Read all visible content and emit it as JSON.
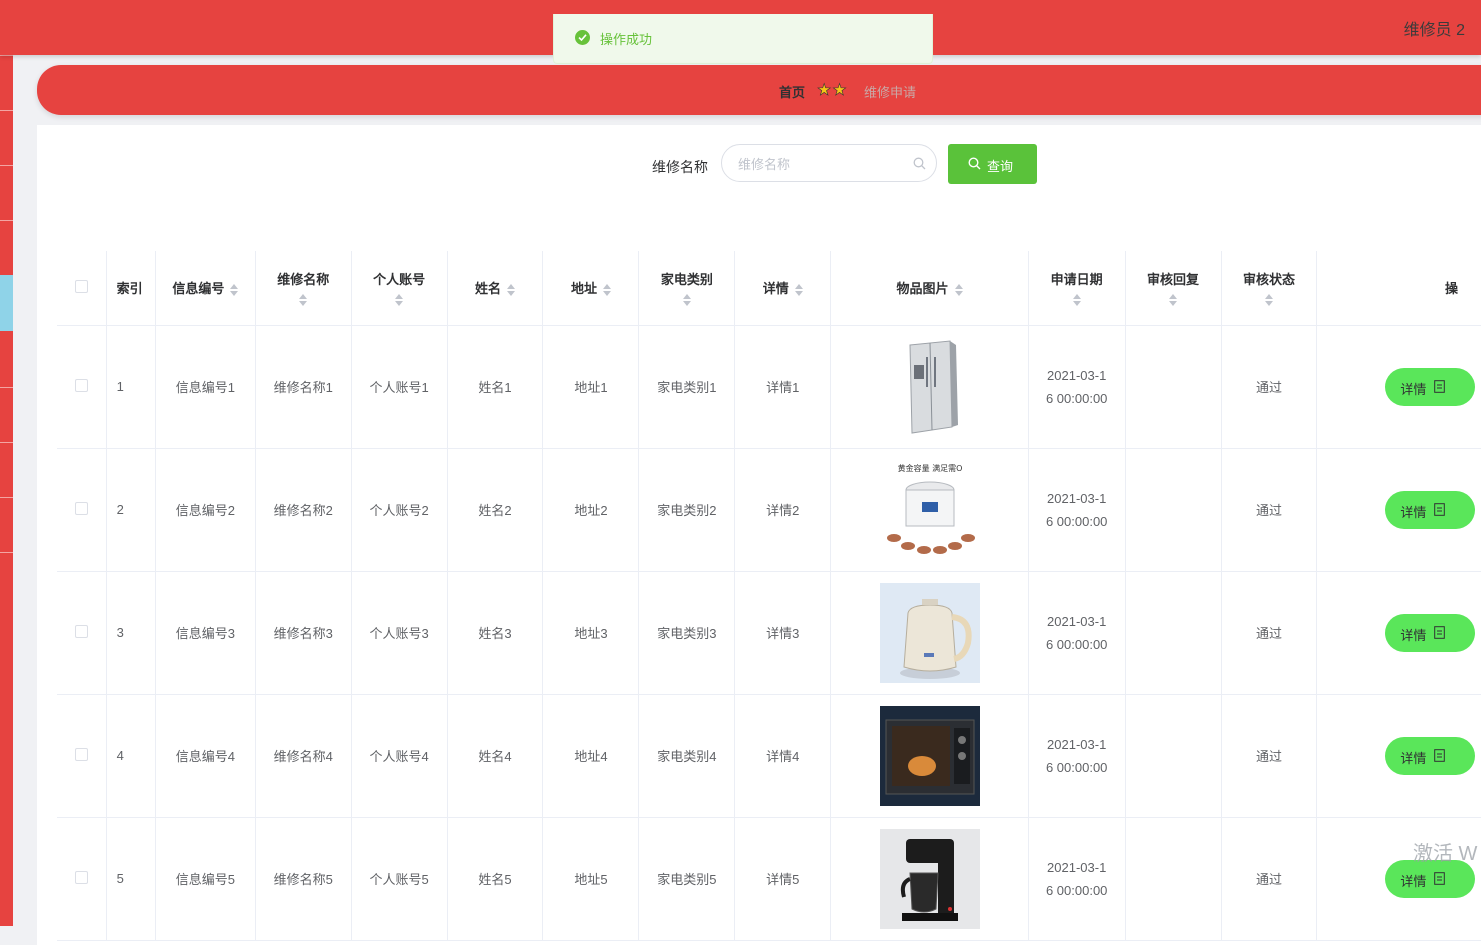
{
  "header": {
    "user_label": "维修员 2"
  },
  "toast": {
    "message": "操作成功"
  },
  "breadcrumb": {
    "home": "首页",
    "separator": "★★",
    "current": "维修申请"
  },
  "search": {
    "label": "维修名称",
    "placeholder": "维修名称",
    "button_label": "查询"
  },
  "table": {
    "headers": {
      "index": "索引",
      "info_no": "信息编号",
      "repair_name": "维修名称",
      "account": "个人账号",
      "name": "姓名",
      "address": "地址",
      "category": "家电类别",
      "detail": "详情",
      "image": "物品图片",
      "apply_date": "申请日期",
      "review_reply": "审核回复",
      "review_status": "审核状态",
      "ops_partial": "操"
    },
    "rows": [
      {
        "index": "1",
        "info_no": "信息编号1",
        "repair_name": "维修名称1",
        "account": "个人账号1",
        "name": "姓名1",
        "address": "地址1",
        "category": "家电类别1",
        "detail": "详情1",
        "image_icon": "refrigerator-image",
        "date_line1": "2021-03-1",
        "date_line2": "6 00:00:00",
        "review_reply": "",
        "review_status": "通过",
        "button": "详情"
      },
      {
        "index": "2",
        "info_no": "信息编号2",
        "repair_name": "维修名称2",
        "account": "个人账号2",
        "name": "姓名2",
        "address": "地址2",
        "category": "家电类别2",
        "detail": "详情2",
        "image_icon": "rice-cooker-image",
        "image_caption": "黄金容量 满足需O",
        "date_line1": "2021-03-1",
        "date_line2": "6 00:00:00",
        "review_reply": "",
        "review_status": "通过",
        "button": "详情"
      },
      {
        "index": "3",
        "info_no": "信息编号3",
        "repair_name": "维修名称3",
        "account": "个人账号3",
        "name": "姓名3",
        "address": "地址3",
        "category": "家电类别3",
        "detail": "详情3",
        "image_icon": "kettle-image",
        "date_line1": "2021-03-1",
        "date_line2": "6 00:00:00",
        "review_reply": "",
        "review_status": "通过",
        "button": "详情"
      },
      {
        "index": "4",
        "info_no": "信息编号4",
        "repair_name": "维修名称4",
        "account": "个人账号4",
        "name": "姓名4",
        "address": "地址4",
        "category": "家电类别4",
        "detail": "详情4",
        "image_icon": "microwave-image",
        "date_line1": "2021-03-1",
        "date_line2": "6 00:00:00",
        "review_reply": "",
        "review_status": "通过",
        "button": "详情"
      },
      {
        "index": "5",
        "info_no": "信息编号5",
        "repair_name": "维修名称5",
        "account": "个人账号5",
        "name": "姓名5",
        "address": "地址5",
        "category": "家电类别5",
        "detail": "详情5",
        "image_icon": "coffee-maker-image",
        "date_line1": "2021-03-1",
        "date_line2": "6 00:00:00",
        "review_reply": "",
        "review_status": "通过",
        "button": "详情"
      }
    ]
  },
  "watermark": "激活 W",
  "colors": {
    "primary_red": "#e64340",
    "success_green": "#5ac23a",
    "detail_green": "#5ae65a",
    "sidebar_active": "#8fd3e8"
  }
}
